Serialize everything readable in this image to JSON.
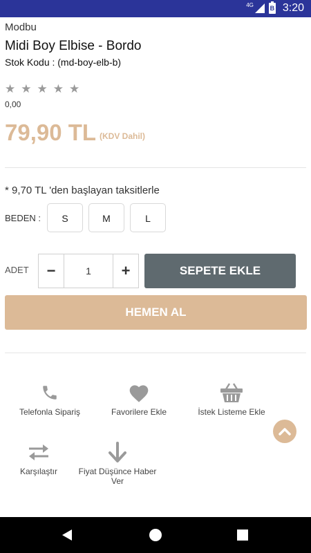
{
  "status_bar": {
    "network": "4G",
    "battery": "B",
    "time": "3:20"
  },
  "product": {
    "brand": "Modbu",
    "title": "Midi Boy Elbise - Bordo",
    "sku": "Stok Kodu : (md-boy-elb-b)",
    "rating_value": "0,00",
    "stars_filled": 0,
    "stars_total": 5,
    "price": "79,90 TL",
    "vat_note": "(KDV Dahil)",
    "installment_text": "* 9,70 TL 'den başlayan taksitlerle"
  },
  "size": {
    "label": "BEDEN :",
    "options": [
      "S",
      "M",
      "L"
    ]
  },
  "quantity": {
    "label": "ADET",
    "minus": "−",
    "value": "1",
    "plus": "+"
  },
  "buttons": {
    "add_to_cart": "SEPETE EKLE",
    "buy_now": "HEMEN AL"
  },
  "actions": [
    {
      "icon": "phone-icon",
      "label": "Telefonla Sipariş"
    },
    {
      "icon": "heart-icon",
      "label": "Favorilere Ekle"
    },
    {
      "icon": "basket-icon",
      "label": "İstek Listeme Ekle"
    },
    {
      "icon": "compare-arrows-icon",
      "label": "Karşılaştır"
    },
    {
      "icon": "arrow-down-icon",
      "label": "Fiyat Düşünce Haber Ver"
    }
  ],
  "colors": {
    "accent": "#dcba97",
    "cart_button": "#5f6a6f",
    "status_bar": "#2b3499",
    "icon_gray": "#9a9a9a"
  }
}
